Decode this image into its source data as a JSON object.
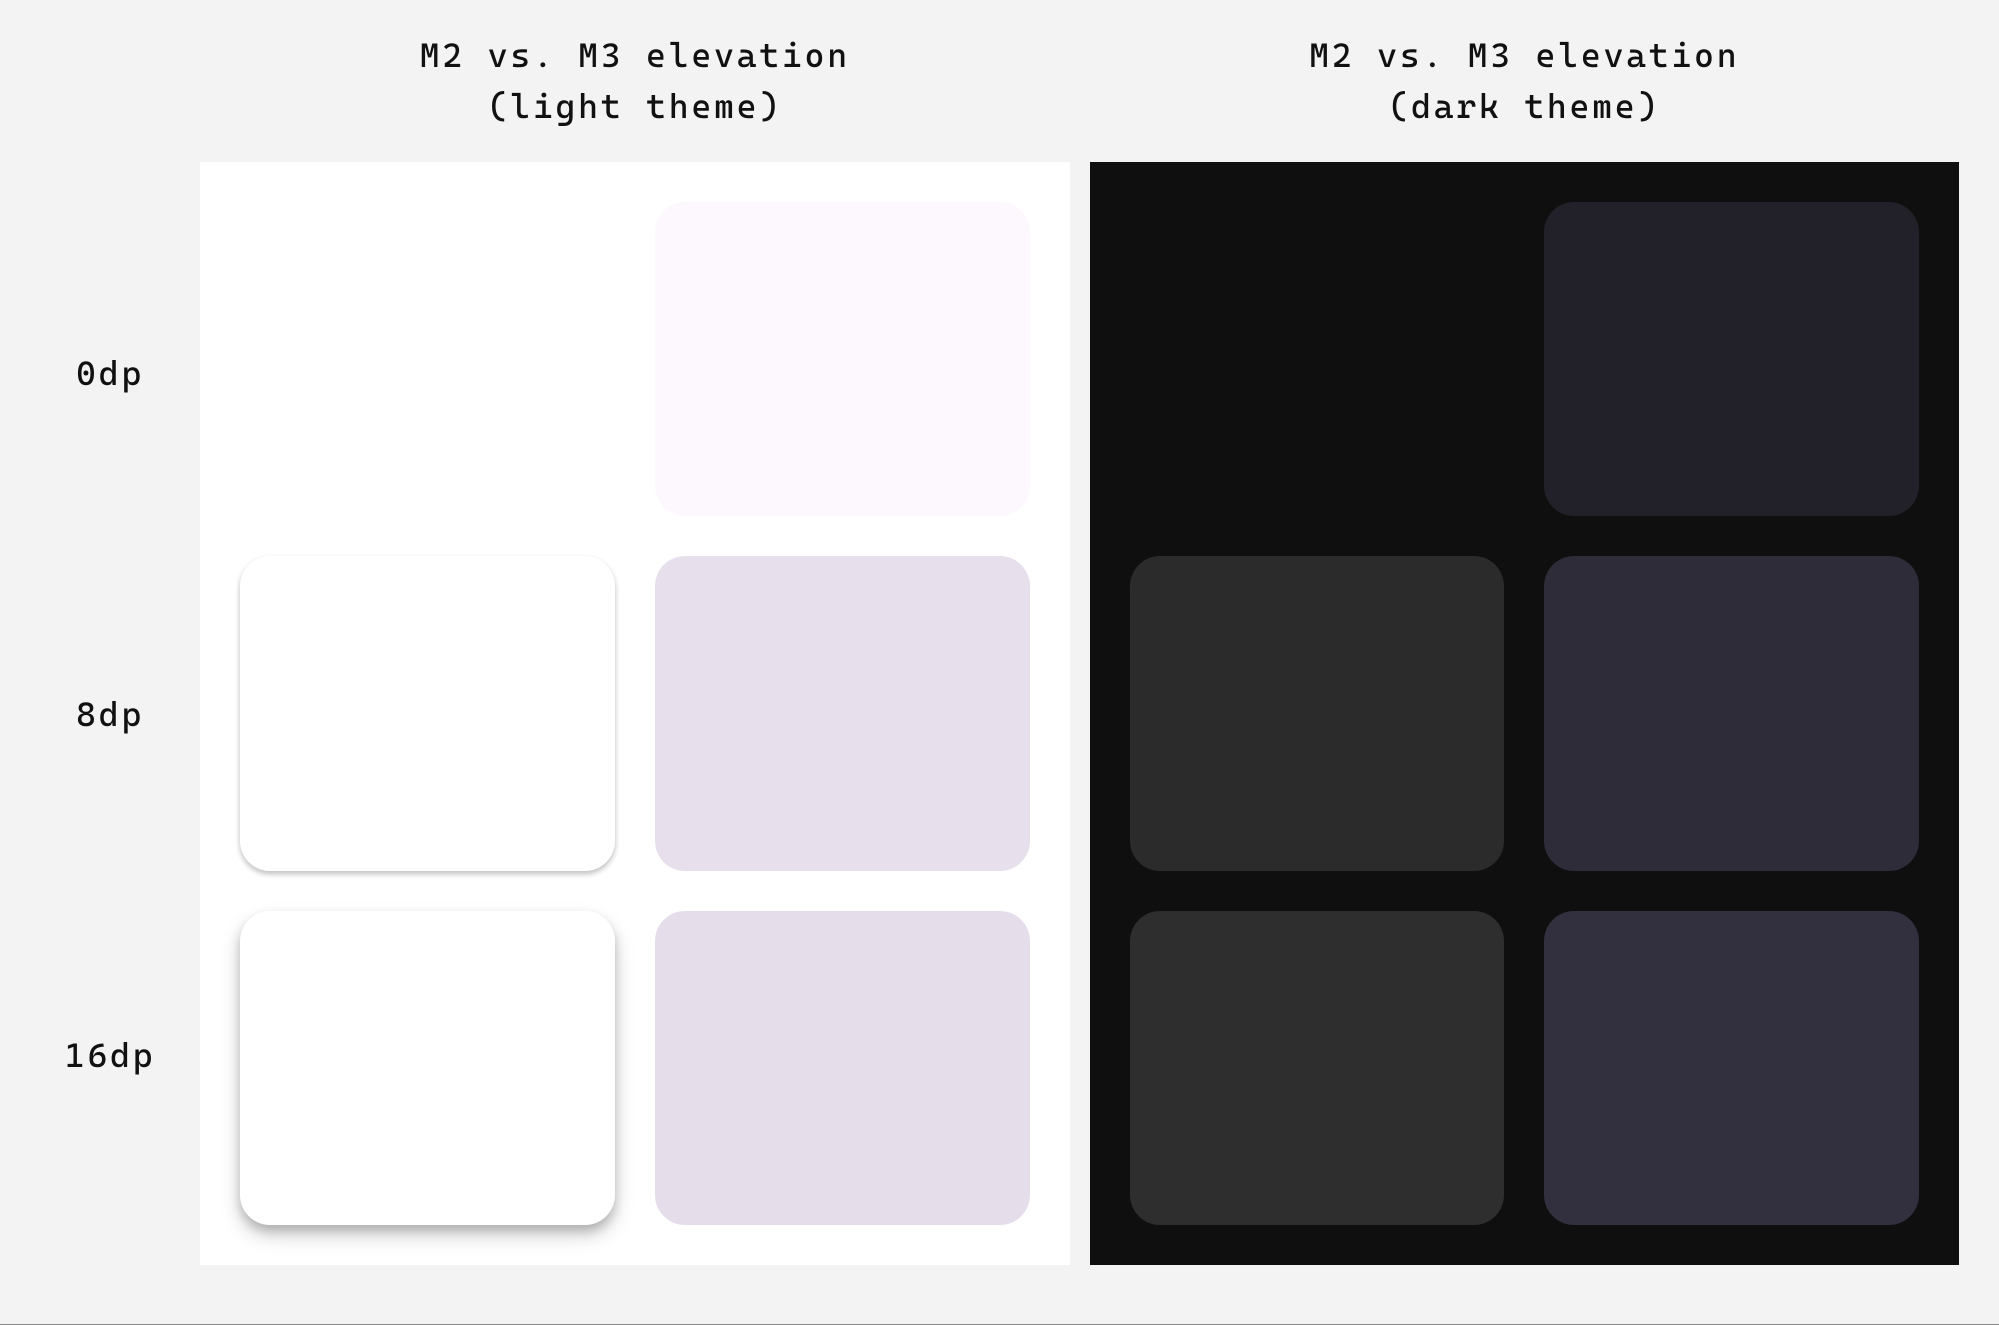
{
  "headers": {
    "light": "M2 vs. M3 elevation\n(light theme)",
    "dark": "M2 vs. M3 elevation\n(dark theme)"
  },
  "rowLabels": [
    "0dp",
    "8dp",
    "16dp"
  ],
  "cards": {
    "light": [
      {
        "visible": false,
        "bg": "#ffffff",
        "shadow": "none"
      },
      {
        "visible": true,
        "bg": "#fdf8fe",
        "shadow": "none"
      },
      {
        "visible": true,
        "bg": "#ffffff",
        "shadow": "0 3px 6px rgba(0,0,0,0.12), 0 3px 6px rgba(0,0,0,0.15)"
      },
      {
        "visible": true,
        "bg": "#e7e0ec",
        "shadow": "none"
      },
      {
        "visible": true,
        "bg": "#ffffff",
        "shadow": "0 10px 20px rgba(0,0,0,0.18), 0 6px 10px rgba(0,0,0,0.18)"
      },
      {
        "visible": true,
        "bg": "#e5deea",
        "shadow": "none"
      }
    ],
    "dark": [
      {
        "visible": false,
        "bg": "#0f0f0f",
        "shadow": "none"
      },
      {
        "visible": true,
        "bg": "#222028",
        "shadow": "none"
      },
      {
        "visible": true,
        "bg": "#2b2b2b",
        "shadow": "none"
      },
      {
        "visible": true,
        "bg": "#2d2c38",
        "shadow": "none"
      },
      {
        "visible": true,
        "bg": "#2e2e2e",
        "shadow": "none"
      },
      {
        "visible": true,
        "bg": "#322f3f",
        "shadow": "none"
      }
    ]
  }
}
